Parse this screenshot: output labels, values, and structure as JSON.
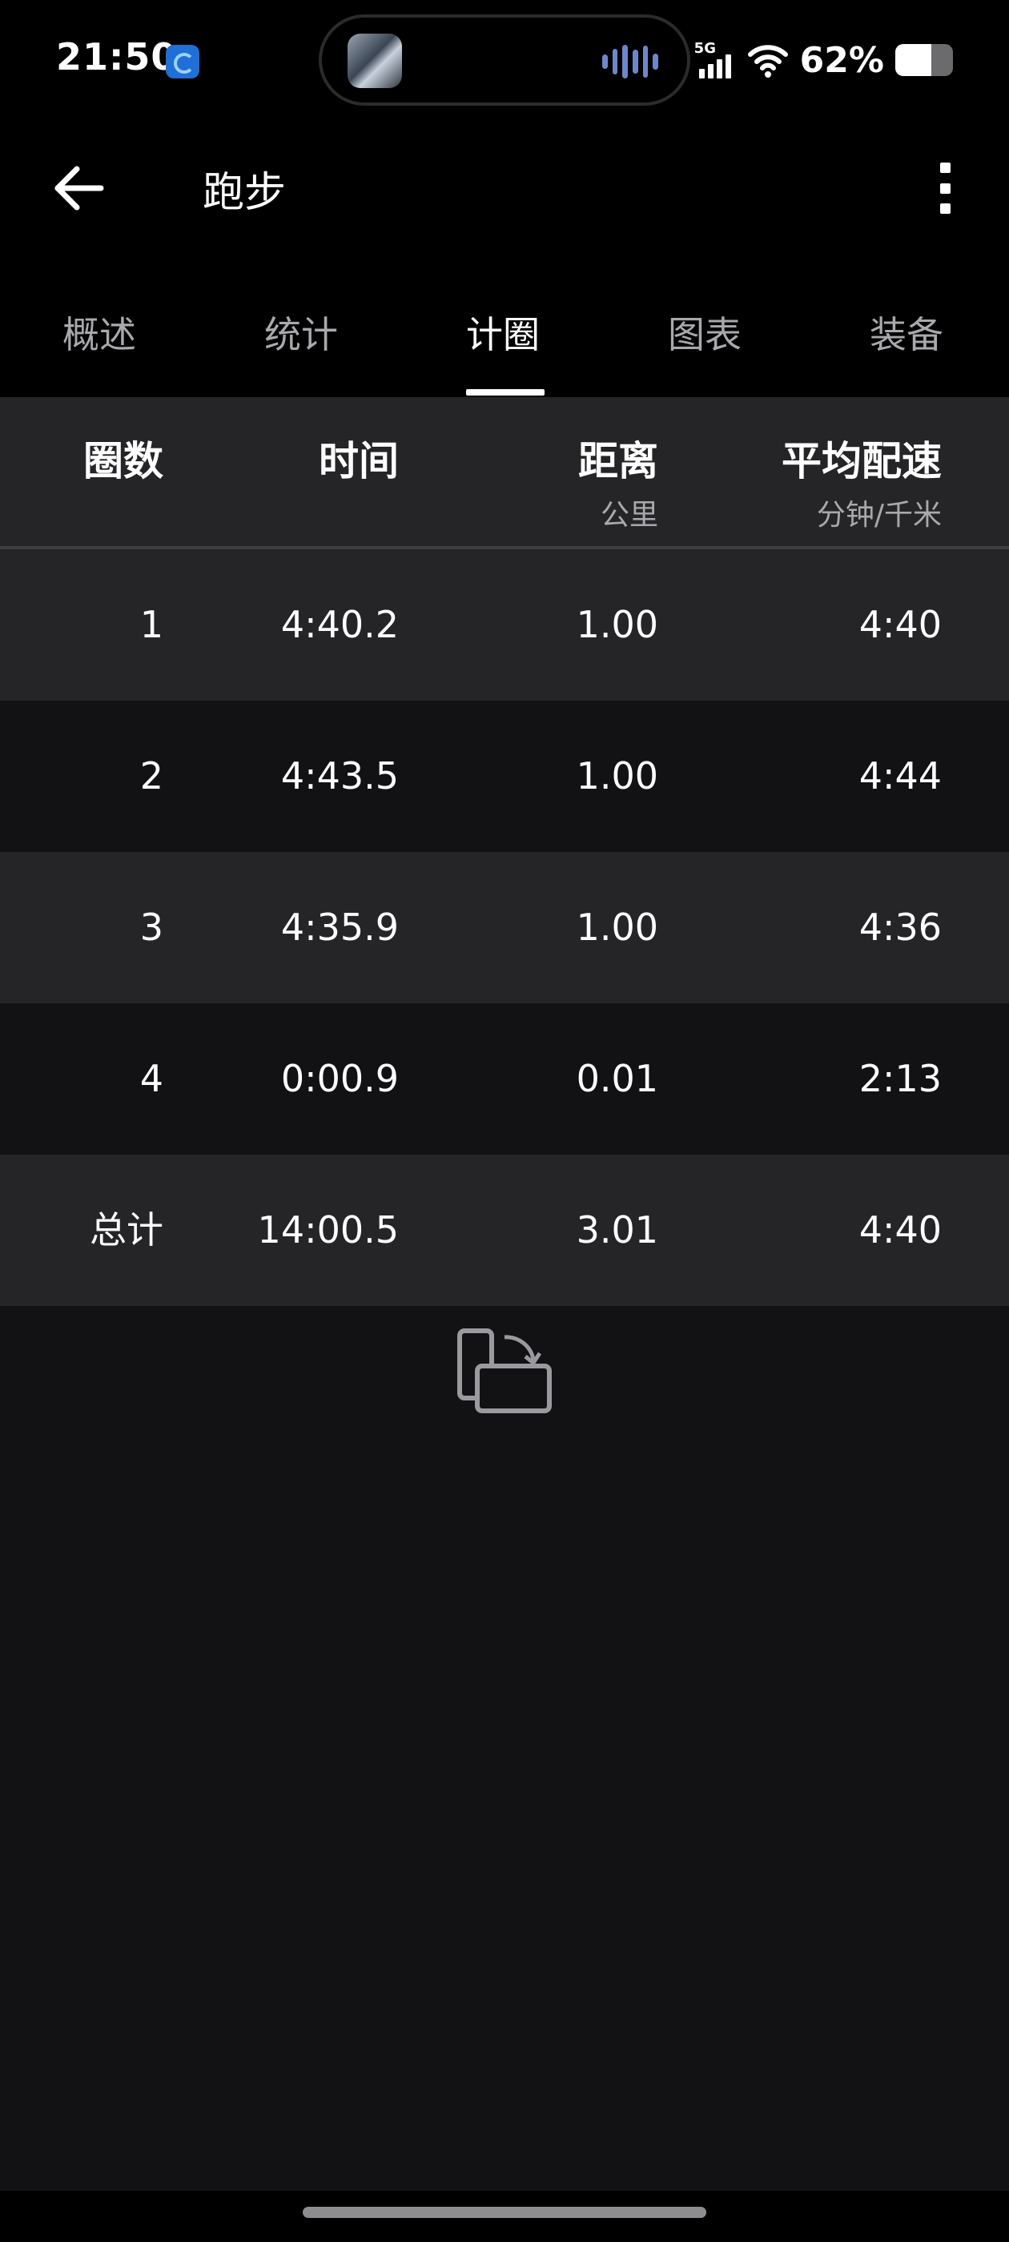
{
  "status_bar": {
    "time": "21:50",
    "network": "5G",
    "battery_percent": "62%",
    "battery_level": 0.62
  },
  "header": {
    "title": "跑步",
    "back_icon": "arrow-left-icon",
    "more_icon": "more-vertical-icon"
  },
  "tabs": [
    {
      "label": "概述",
      "active": false
    },
    {
      "label": "统计",
      "active": false
    },
    {
      "label": "计圈",
      "active": true
    },
    {
      "label": "图表",
      "active": false
    },
    {
      "label": "装备",
      "active": false
    }
  ],
  "laps_table": {
    "columns": [
      {
        "label": "圈数",
        "unit": ""
      },
      {
        "label": "时间",
        "unit": ""
      },
      {
        "label": "距离",
        "unit": "公里"
      },
      {
        "label": "平均配速",
        "unit": "分钟/千米"
      }
    ],
    "rows": [
      [
        "1",
        "4:40.2",
        "1.00",
        "4:40"
      ],
      [
        "2",
        "4:43.5",
        "1.00",
        "4:44"
      ],
      [
        "3",
        "4:35.9",
        "1.00",
        "4:36"
      ],
      [
        "4",
        "0:00.9",
        "0.01",
        "2:13"
      ]
    ],
    "total": [
      "总计",
      "14:00.5",
      "3.01",
      "4:40"
    ]
  },
  "rotate_icon": "screen-rotate-icon",
  "colors": {
    "background": "#121114",
    "row_light": "#252527",
    "text_secondary": "#a9a9ad"
  }
}
